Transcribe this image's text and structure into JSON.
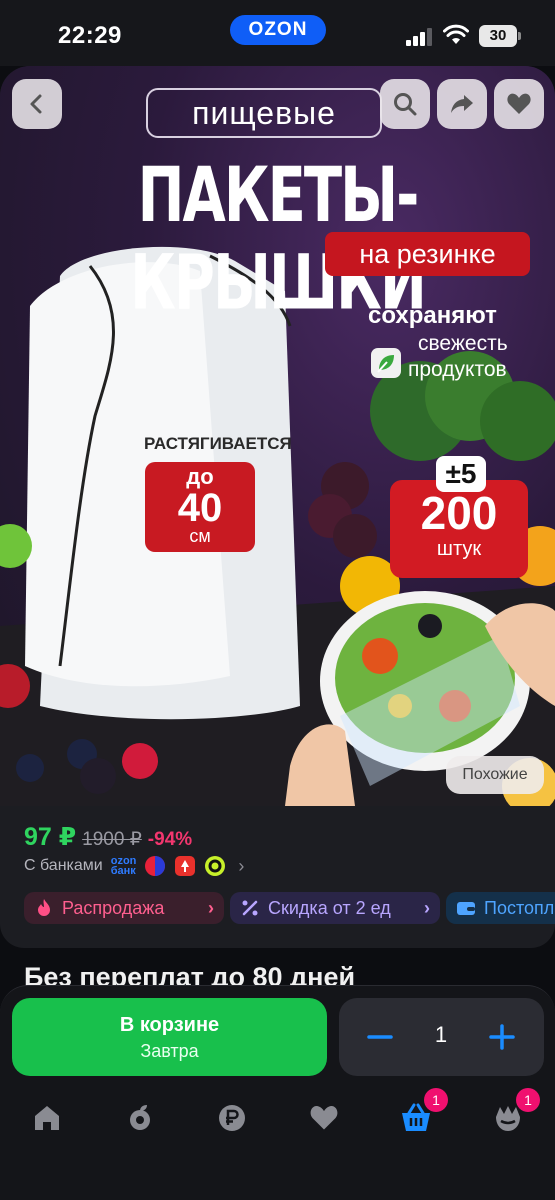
{
  "status_bar": {
    "time": "22:29",
    "brand": "OZON",
    "battery": "30"
  },
  "hero": {
    "tag": "пищевые",
    "title": "ПАКЕТЫ-КРЫШКИ",
    "subtitle": "на резинке",
    "keeps": "сохраняют",
    "fresh_line1": "свежесть",
    "fresh_line2": "продуктов",
    "stretch_label": "РАСТЯГИВАЕТСЯ",
    "size_prefix": "до",
    "size_value": "40",
    "size_unit": "см",
    "plus_badge": "±5",
    "count_value": "200",
    "count_unit": "штук",
    "similar_label": "Похожие"
  },
  "price": {
    "current": "97 ₽",
    "old": "1900 ₽",
    "discount": "-94%"
  },
  "banks": {
    "label": "С банками",
    "ozon_bank_line1": "ozon",
    "ozon_bank_line2": "банк"
  },
  "chips": [
    {
      "label": "Распродажа"
    },
    {
      "label": "Скидка от 2 ед"
    },
    {
      "label": "Постоплата"
    }
  ],
  "overpay_text": "Без переплат до 80 дней",
  "cart": {
    "title": "В корзине",
    "subtitle": "Завтра",
    "quantity": "1"
  },
  "tabs": {
    "cart_badge": "1",
    "profile_badge": "1"
  },
  "colors": {
    "accent_green": "#18c04c",
    "price_green": "#2fd45f",
    "discount_pink": "#f2366e",
    "badge_pink": "#f0106f",
    "ozon_blue": "#0f5ef7",
    "active_tab": "#1a8cff"
  },
  "icons": [
    "back-icon",
    "search-icon",
    "share-icon",
    "heart-icon",
    "home-icon",
    "fresh-icon",
    "ruble-icon",
    "favorites-icon",
    "cart-icon",
    "profile-icon",
    "minus-icon",
    "plus-icon"
  ]
}
